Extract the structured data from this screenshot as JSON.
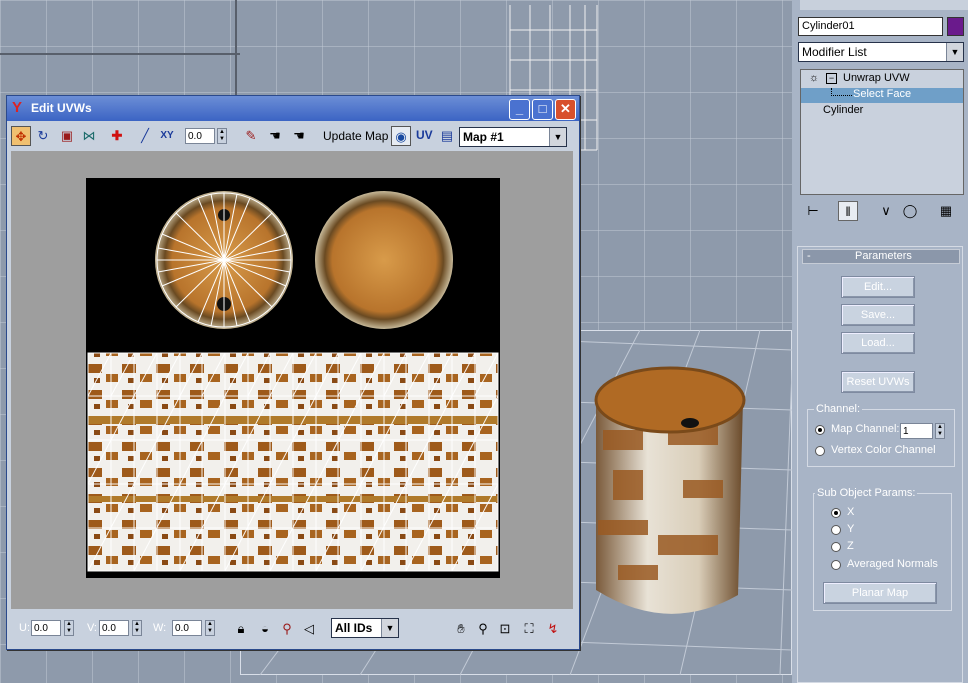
{
  "object_name": "Cylinder01",
  "object_color": "#6a1a8c",
  "modifier_list": {
    "label": "Modifier List"
  },
  "modifier_stack": [
    {
      "label": "Unwrap UVW",
      "expanded": true
    },
    {
      "label": "Select Face",
      "selected": true
    },
    {
      "label": "Cylinder"
    }
  ],
  "parameters": {
    "title": "Parameters",
    "collapse_symbol": "-",
    "buttons": {
      "edit": "Edit...",
      "save": "Save...",
      "load": "Load...",
      "reset": "Reset UVWs"
    },
    "channel": {
      "group_label": "Channel:",
      "map_channel_label": "Map Channel:",
      "map_channel_value": "1",
      "vertex_color_label": "Vertex Color Channel",
      "selected": "map_channel"
    },
    "sub_object": {
      "group_label": "Sub Object Params:",
      "options": [
        "X",
        "Y",
        "Z",
        "Averaged Normals"
      ],
      "selected": "X",
      "planar_map_button": "Planar Map"
    }
  },
  "edit_uvw": {
    "title": "Edit UVWs",
    "toolbar": {
      "spinner_value": "0.0",
      "update_map": "Update Map",
      "uv_label": "UV",
      "map_select": "Map #1"
    },
    "bottom_bar": {
      "u_label": "U:",
      "u_value": "0.0",
      "v_label": "V:",
      "v_value": "0.0",
      "w_label": "W:",
      "w_value": "0.0",
      "ids_select": "All IDs"
    }
  },
  "colors": {
    "viewport_bg": "#8e9aab",
    "grid_line": "#c2cad6",
    "title_bar": "#3b64c4",
    "selected_row": "#6f9fc8"
  }
}
